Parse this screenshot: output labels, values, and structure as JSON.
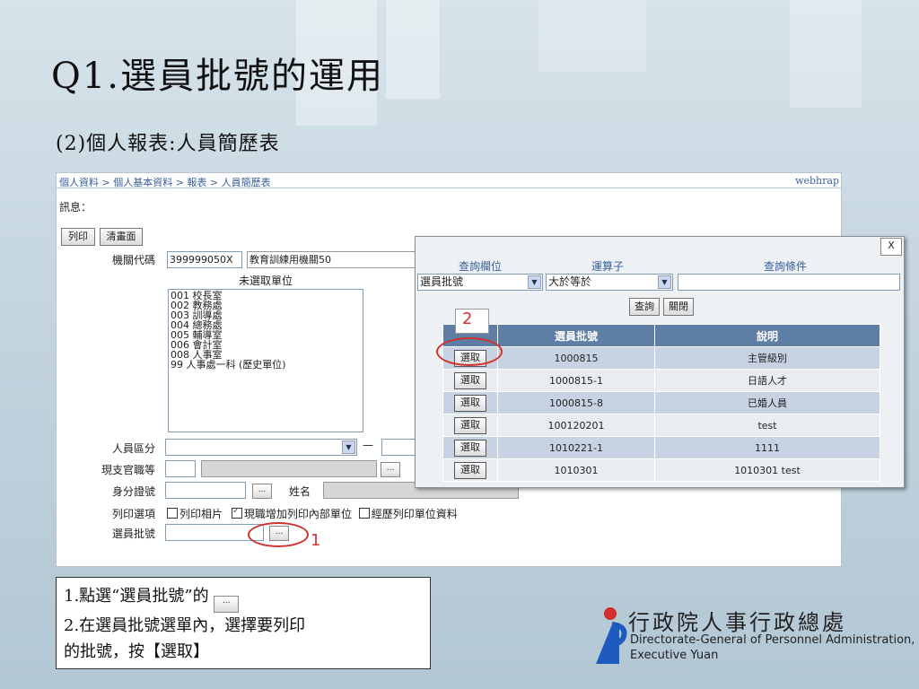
{
  "slide": {
    "title": "Q1.選員批號的運用",
    "subtitle": "(2)個人報表:人員簡歷表"
  },
  "app": {
    "breadcrumb": "個人資料 > 個人基本資料 > 報表 > 人員簡歷表",
    "user": "webhrap",
    "message_label": "訊息：",
    "buttons": {
      "print": "列印",
      "clear": "清畫面"
    },
    "agency": {
      "label": "機關代碼",
      "code": "399999050X",
      "name": "教育訓練用機關50"
    },
    "units": {
      "header": "未選取單位",
      "items": [
        "001 校長室",
        "002 教務處",
        "003 訓導處",
        "004 總務處",
        "005 輔導室",
        "006 會計室",
        "008 人事室",
        "99 人事處一科 (歷史單位)"
      ]
    },
    "fields": {
      "person_category": "人員區分",
      "rank": "現支官職等",
      "id_number": "身分證號",
      "name": "姓名",
      "print_options": "列印選項",
      "batch_number": "選員批號"
    },
    "dots_label": "...",
    "dash": "—",
    "options": {
      "photo": "列印相片",
      "add_units": "現職增加列印內部單位",
      "history_units": "經歷列印單位資料"
    }
  },
  "popup": {
    "close": "X",
    "headers": {
      "field": "查詢欄位",
      "operator": "運算子",
      "condition": "查詢條件"
    },
    "field_value": "選員批號",
    "operator_value": "大於等於",
    "condition_value": "",
    "buttons": {
      "query": "查詢",
      "close": "關閉"
    },
    "columns": [
      "",
      "選員批號",
      "說明"
    ],
    "pick_label": "選取",
    "rows": [
      {
        "batch": "1000815",
        "desc": "主管級別"
      },
      {
        "batch": "1000815-1",
        "desc": "日語人才"
      },
      {
        "batch": "1000815-8",
        "desc": "已婚人員"
      },
      {
        "batch": "100120201",
        "desc": "test"
      },
      {
        "batch": "1010221-1",
        "desc": "1111"
      },
      {
        "batch": "1010301",
        "desc": "1010301 test"
      }
    ]
  },
  "callouts": {
    "one": "1",
    "two": "2",
    "color": "#d2312c"
  },
  "note": {
    "line1_pre": "1.點選“選員批號”的",
    "line2": "2.在選員批號選單內，選擇要列印",
    "line3": "的批號，按【選取】"
  },
  "logo": {
    "cn": "行政院人事行政總處",
    "en1": "Directorate-General of Personnel Administration,",
    "en2": "Executive Yuan"
  }
}
